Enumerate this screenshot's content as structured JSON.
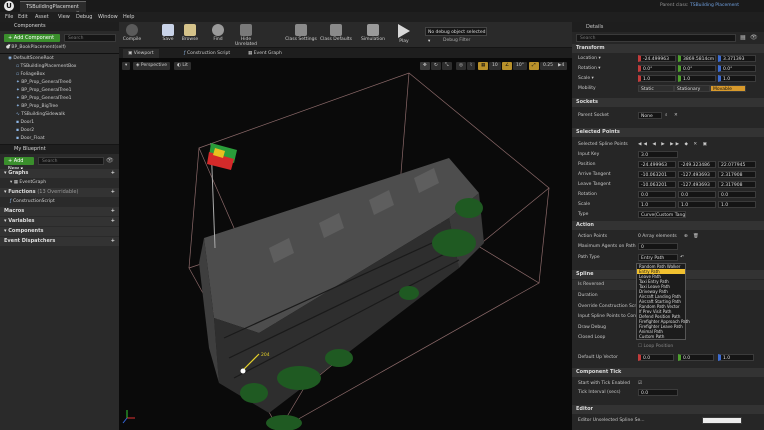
{
  "window": {
    "tab_title": "TSBuildingPlacement",
    "parent_class_label": "Parent class:",
    "parent_class_value": "TSBuilding Placement"
  },
  "menu": [
    "File",
    "Edit",
    "Asset",
    "View",
    "Debug",
    "Window",
    "Help"
  ],
  "components": {
    "header": "Components",
    "add_button": "+ Add Component ▾",
    "search_placeholder": "Search",
    "self_item": "BP_BookPlacement(self)",
    "items": [
      "DefaultSceneRoot",
      "TSBuildingPlacementBox",
      "FoliageBox",
      "BP_Prop_GeneralTree0",
      "BP_Prop_GeneralTree1",
      "BP_Prop_GeneralTree1",
      "BP_Prop_BigTree",
      "TSBuildingSidewalk",
      "Door1",
      "Door2",
      "Door_Float"
    ]
  },
  "my_blueprint": {
    "header": "My Blueprint",
    "add_button": "+ Add New ▾",
    "search_placeholder": "Search",
    "graphs_label": "Graphs",
    "event_graph": "EventGraph",
    "functions_label": "Functions",
    "functions_count": "(13 Overridable)",
    "construction_script": "ConstructionScript",
    "macros_label": "Macros",
    "variables_label": "Variables",
    "components_label": "Components",
    "event_dispatchers_label": "Event Dispatchers"
  },
  "toolbar": {
    "compile": "Compile",
    "save": "Save",
    "browse": "Browse",
    "find": "Find",
    "hide_unrelated": "Hide Unrelated",
    "class_settings": "Class Settings",
    "class_defaults": "Class Defaults",
    "simulation": "Simulation",
    "play": "Play",
    "debug_select": "No debug object selected ▾",
    "debug_filter": "Debug Filter"
  },
  "viewport": {
    "tabs": [
      "Viewport",
      "Construction Script",
      "Event Graph"
    ],
    "perspective": "Perspective",
    "lit": "Lit",
    "grid_value": "10",
    "angle_value": "10°",
    "scale_value": "0.25",
    "camera_speed": "4",
    "distance_label": "204"
  },
  "details": {
    "header": "Details",
    "search_placeholder": "Search",
    "transform": {
      "title": "Transform",
      "location_label": "Location ▾",
      "location": [
        "-24.499963",
        "3869.5814cm",
        "3.371393"
      ],
      "rotation_label": "Rotation ▾",
      "rotation": [
        "0.0°",
        "0.0°",
        "0.0°"
      ],
      "scale_label": "Scale ▾",
      "scale": [
        "1.0",
        "1.0",
        "1.0"
      ],
      "mobility_label": "Mobility",
      "mobility_options": [
        "Static",
        "Stationary",
        "Movable"
      ]
    },
    "sockets": {
      "title": "Sockets",
      "parent_socket_label": "Parent Socket",
      "parent_socket_value": "None"
    },
    "selected_points": {
      "title": "Selected Points",
      "selected_label": "Selected Spline Points",
      "input_key_label": "Input Key",
      "input_key": "3.0",
      "position_label": "Position",
      "position": [
        "-24.499963",
        "-249.323486",
        "22.077945"
      ],
      "arrive_label": "Arrive Tangent",
      "arrive": [
        "-10.063201",
        "-127.493693",
        "2.317908"
      ],
      "leave_label": "Leave Tangent",
      "leave": [
        "-10.063201",
        "-127.493693",
        "2.317908"
      ],
      "rotation_label": "Rotation",
      "rotation": [
        "0.0",
        "0.0",
        "0.0"
      ],
      "scale_label": "Scale",
      "scale": [
        "1.0",
        "1.0",
        "1.0"
      ],
      "type_label": "Type",
      "type_value": "Curve(Custom Tangent)"
    },
    "action": {
      "title": "Action",
      "action_points_label": "Action Points",
      "action_points_value": "0 Array elements",
      "max_agents_label": "Maximum Agents on Path",
      "max_agents_value": "0",
      "path_type_label": "Path Type",
      "path_type_value": "Entry Path"
    },
    "path_type_options": [
      "Random Path Walker",
      "Entry Path",
      "Leave Path",
      "Taxi Entry Path",
      "Taxi Leave Path",
      "Driveway Path",
      "Aircraft Landing Path",
      "Aircraft Starting Path",
      "Random Path Vector",
      "If Prev Visit Path",
      "Defend Position Path",
      "Firefighter Approach Path",
      "Firefighter Leave Path",
      "Animal Path",
      "Custom Path"
    ],
    "spline": {
      "title": "Spline",
      "is_reversed_label": "Is Reversed",
      "duration_label": "Duration",
      "override_label": "Override Construction Script",
      "input_label": "Input Spline Points to Constr...",
      "draw_debug_label": "Draw Debug",
      "closed_loop_label": "Closed Loop",
      "loop_position_label": "Loop Position",
      "default_up_label": "Default Up Vector",
      "default_up": [
        "0.0",
        "0.0",
        "1.0"
      ]
    },
    "component_tick": {
      "title": "Component Tick",
      "start_enabled_label": "Start with Tick Enabled",
      "tick_interval_label": "Tick Interval (secs)",
      "tick_interval_value": "0.0"
    },
    "editor": {
      "title": "Editor",
      "unselected_label": "Editor Unselected Spline Se..."
    }
  }
}
